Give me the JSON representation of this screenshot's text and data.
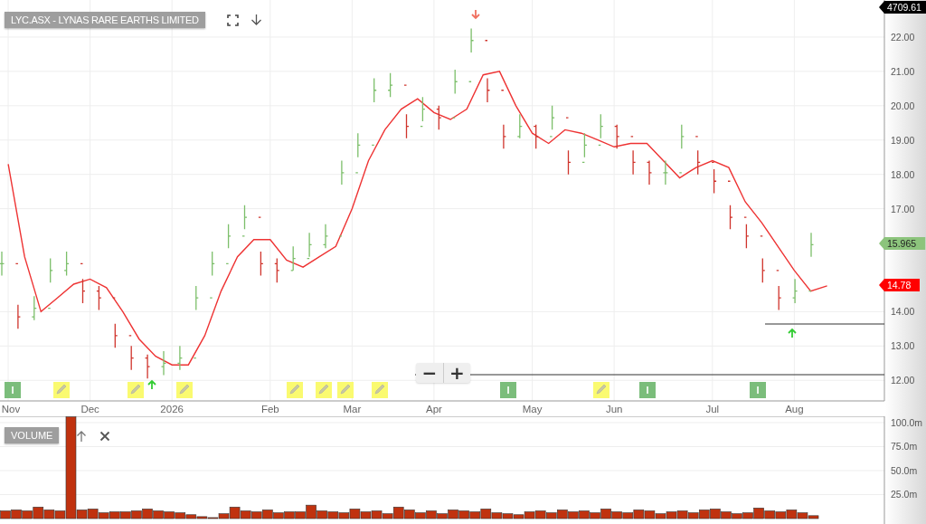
{
  "header": {
    "title": "LYC.ASX - LYNAS RARE EARTHS LIMITED"
  },
  "price_chart": {
    "zoom_controls": [
      "−",
      "+"
    ],
    "price_flags": [
      {
        "text": "4709.61",
        "color": "#000000"
      },
      {
        "text": "15.965",
        "color": "#8cc47c"
      },
      {
        "text": "14.78",
        "color": "#ff0000"
      }
    ],
    "signals": [
      {
        "kind": "down"
      },
      {
        "kind": "up"
      },
      {
        "kind": "up"
      }
    ],
    "events": [
      {
        "kind": "info",
        "label": "I"
      },
      {
        "kind": "note"
      },
      {
        "kind": "note"
      },
      {
        "kind": "note"
      },
      {
        "kind": "note"
      },
      {
        "kind": "note"
      },
      {
        "kind": "note"
      },
      {
        "kind": "note"
      },
      {
        "kind": "info",
        "label": "I"
      },
      {
        "kind": "note"
      },
      {
        "kind": "info",
        "label": "I"
      },
      {
        "kind": "info",
        "label": "I"
      }
    ],
    "chart_data": {
      "type": "line",
      "grid": true,
      "categories": [
        "Nov",
        null,
        null,
        null,
        null,
        "Dec",
        null,
        null,
        null,
        null,
        "2026",
        null,
        null,
        null,
        null,
        null,
        "Feb",
        null,
        null,
        null,
        null,
        "Mar",
        null,
        null,
        null,
        null,
        "Apr",
        null,
        null,
        null,
        null,
        null,
        "May",
        null,
        null,
        null,
        null,
        "Jun",
        null,
        null,
        null,
        null,
        null,
        "Jul",
        null,
        null,
        null,
        null,
        "Aug",
        null,
        null,
        null,
        null,
        null
      ],
      "series": [
        {
          "color": "#ee3333",
          "values": [
            18.3,
            15.6,
            14.0,
            14.4,
            14.8,
            14.95,
            14.7,
            14.0,
            13.2,
            12.7,
            12.45,
            12.45,
            13.3,
            14.6,
            15.6,
            16.1,
            16.1,
            15.5,
            15.3,
            15.6,
            15.9,
            17.0,
            18.4,
            19.3,
            19.9,
            20.2,
            19.8,
            19.6,
            19.9,
            20.9,
            21.0,
            20.0,
            19.2,
            18.9,
            19.3,
            19.2,
            19.0,
            18.8,
            18.9,
            18.9,
            18.4,
            17.9,
            18.2,
            18.4,
            18.2,
            17.2,
            16.6,
            15.9,
            15.2,
            14.6,
            14.75,
            null,
            null,
            null
          ]
        }
      ],
      "ylim": [
        11.4,
        23.08
      ],
      "yticks": [
        {
          "value": 12,
          "label": "12.00"
        },
        {
          "value": 13,
          "label": "13.00"
        },
        {
          "value": 14,
          "label": "14.00"
        },
        {
          "value": 17,
          "label": "17.00"
        },
        {
          "value": 18,
          "label": "18.00"
        },
        {
          "value": 19,
          "label": "19.00"
        },
        {
          "value": 20,
          "label": "20.00"
        },
        {
          "value": 21,
          "label": "21.00"
        },
        {
          "value": 22,
          "label": "22.00"
        }
      ]
    }
  },
  "volume_panel": {
    "title": "VOLUME",
    "chart_data": {
      "type": "bar",
      "grid": true,
      "categories": [
        null,
        null,
        null,
        null,
        null,
        null,
        null,
        null,
        null,
        null,
        null,
        null,
        null,
        null,
        null,
        null,
        null,
        null,
        null,
        null,
        null,
        null,
        null,
        null,
        null,
        null,
        null,
        null,
        null,
        null,
        null,
        null,
        null,
        null,
        null,
        null,
        null,
        null,
        null,
        null,
        null,
        null,
        null,
        null,
        null,
        null,
        null,
        null,
        null,
        null,
        null,
        null,
        null,
        null,
        null,
        null,
        null,
        null,
        null,
        null,
        null,
        null,
        null,
        null,
        null,
        null,
        null,
        null,
        null,
        null,
        null,
        null,
        null,
        null,
        null,
        null,
        null,
        null,
        null,
        null,
        null
      ],
      "series": [
        {
          "color": "#c0320f",
          "values": [
            8,
            9,
            8,
            12,
            9,
            8,
            106,
            9,
            10,
            6,
            7,
            7,
            8,
            10,
            8,
            7,
            6,
            4,
            2,
            1,
            5,
            12,
            8,
            7,
            9,
            6,
            7,
            7,
            14,
            8,
            7,
            6,
            10,
            7,
            8,
            5,
            12,
            9,
            6,
            8,
            5,
            9,
            8,
            7,
            10,
            6,
            5,
            4,
            7,
            8,
            6,
            9,
            7,
            8,
            6,
            10,
            7,
            6,
            9,
            8,
            5,
            7,
            8,
            6,
            9,
            10,
            7,
            5,
            6,
            11,
            8,
            7,
            9,
            6,
            3,
            null,
            null,
            null,
            null,
            null,
            null
          ]
        }
      ],
      "ylim": [
        0,
        106.6
      ],
      "yticks": [
        {
          "value": 25,
          "label": "25.0m"
        },
        {
          "value": 50,
          "label": "50.0m"
        },
        {
          "value": 75,
          "label": "75.0m"
        },
        {
          "value": 100,
          "label": "100.0m"
        }
      ]
    }
  }
}
